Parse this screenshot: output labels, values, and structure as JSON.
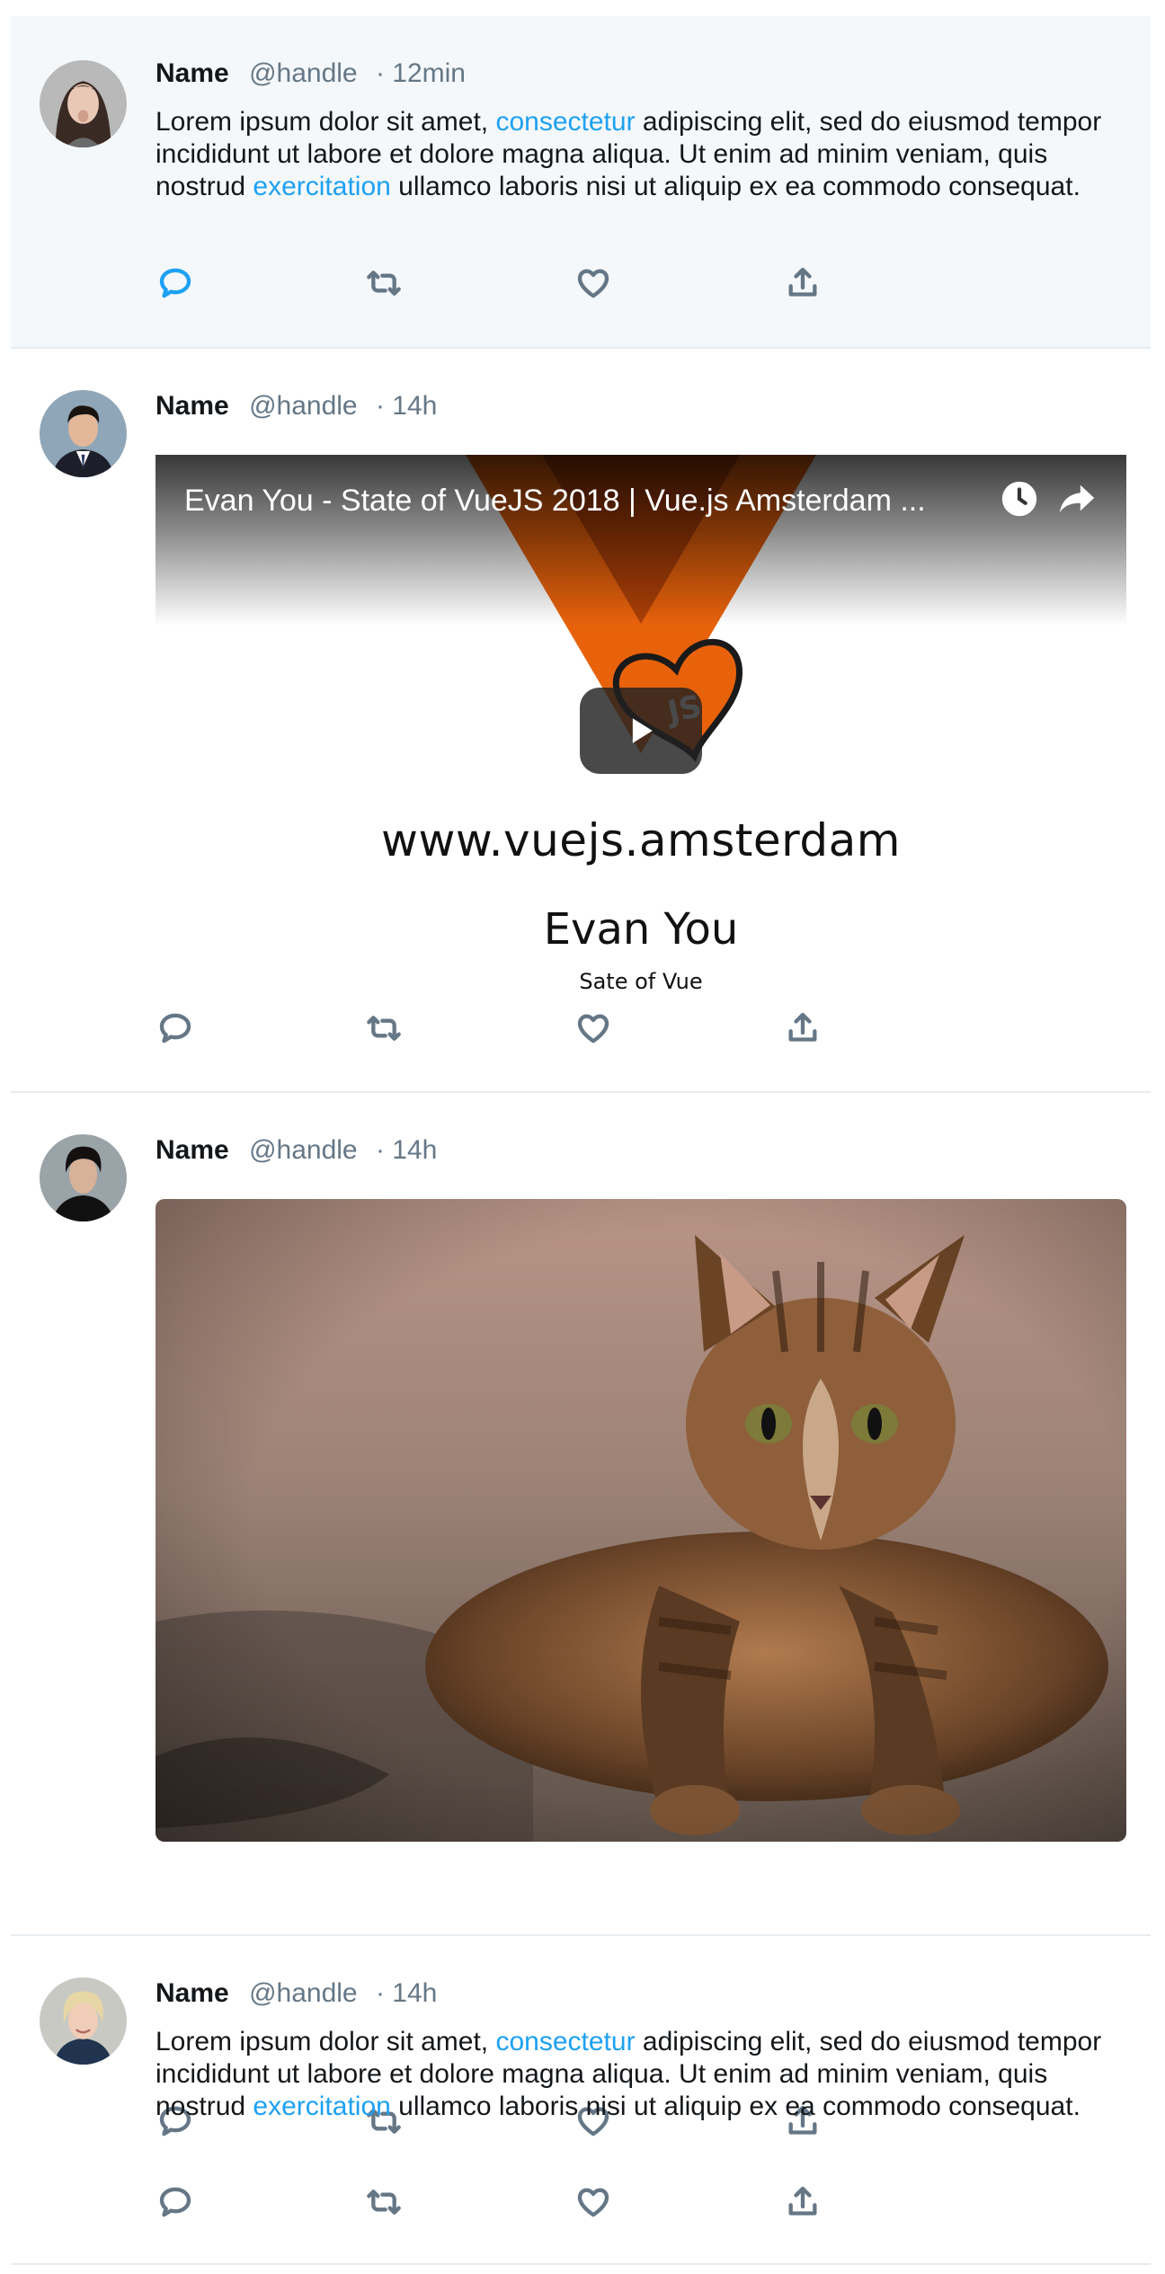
{
  "tweets": [
    {
      "name": "Name",
      "handle": "@handle",
      "time": "· 12min",
      "text": {
        "p1": "Lorem ipsum dolor sit amet, ",
        "link1": "consectetur",
        "p2": " adipiscing elit, sed do eiusmod tempor incididunt ut labore et dolore magna aliqua. Ut enim ad minim veniam, quis nostrud ",
        "link2": "exercitation",
        "p3": " ullamco laboris nisi ut aliquip ex ea commodo consequat."
      },
      "highlighted": true
    },
    {
      "name": "Name",
      "handle": "@handle",
      "time": "· 14h",
      "video": {
        "title": "Evan You - State of VueJS 2018 | Vue.js Amsterdam ...",
        "url_text": "www.vuejs.amsterdam",
        "speaker": "Evan You",
        "talk": "Sate of Vue",
        "logo_badge": "JS"
      }
    },
    {
      "name": "Name",
      "handle": "@handle",
      "time": "· 14h",
      "image": "kitten-photo"
    },
    {
      "name": "Name",
      "handle": "@handle",
      "time": "· 14h",
      "text": {
        "p1": "Lorem ipsum dolor sit amet, ",
        "link1": "consectetur",
        "p2": " adipiscing elit, sed do eiusmod tempor incididunt ut labore et dolore magna aliqua. Ut enim ad minim veniam, quis nostrud ",
        "link2": "exercitation",
        "p3": " ullamco laboris nisi ut aliquip ex ea commodo consequat."
      }
    }
  ],
  "action_icons": [
    "reply-icon",
    "retweet-icon",
    "like-icon",
    "share-icon"
  ],
  "colors": {
    "link": "#1da1f2",
    "muted": "#657786",
    "text": "#14171a",
    "highlight_bg": "#f5f8fa",
    "divider": "#e6ecf0",
    "vue_orange": "#e8620c"
  }
}
